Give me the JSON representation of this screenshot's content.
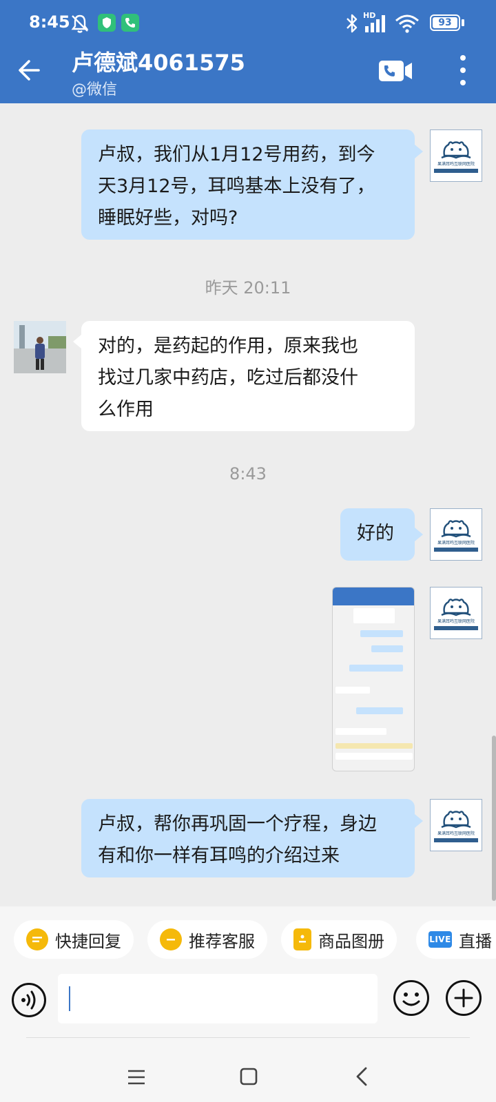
{
  "status_bar": {
    "time": "8:45",
    "network": "HD",
    "battery": "93"
  },
  "header": {
    "title": "卢德斌4061575",
    "subtitle": "@微信"
  },
  "store_avatar": {
    "mini_text": "果满耳鸣互联网医院"
  },
  "messages": [
    {
      "direction": "out",
      "lines": [
        "卢叔，我们从1月12号用药，到今",
        "天3月12号，耳鸣基本上没有了，",
        "睡眠好些，对吗?"
      ]
    },
    {
      "direction": "in",
      "lines": [
        "对的，是药起的作用，原来我也",
        "找过几家中药店，吃过后都没什",
        "么作用"
      ]
    },
    {
      "direction": "out",
      "lines": [
        "好的"
      ]
    },
    {
      "direction": "out",
      "lines": [
        "卢叔，帮你再巩固一个疗程，身边",
        "有和你一样有耳鸣的介绍过来"
      ]
    }
  ],
  "timestamps": {
    "yesterday": "昨天  20:11",
    "today": "8:43"
  },
  "quick_actions": [
    {
      "label": "快捷回复",
      "icon": "quick-reply-icon"
    },
    {
      "label": "推荐客服",
      "icon": "service-icon"
    },
    {
      "label": "商品图册",
      "icon": "catalog-icon"
    },
    {
      "label": "直播",
      "icon": "live-icon",
      "icon_text": "LIVE"
    }
  ],
  "input": {
    "value": ""
  },
  "colors": {
    "header": "#3b76c6",
    "bubble_out": "#c5e2fd",
    "bubble_in": "#ffffff",
    "background": "#ededed",
    "chip_icon": "#f5b90a",
    "live_icon": "#2e89e6"
  }
}
